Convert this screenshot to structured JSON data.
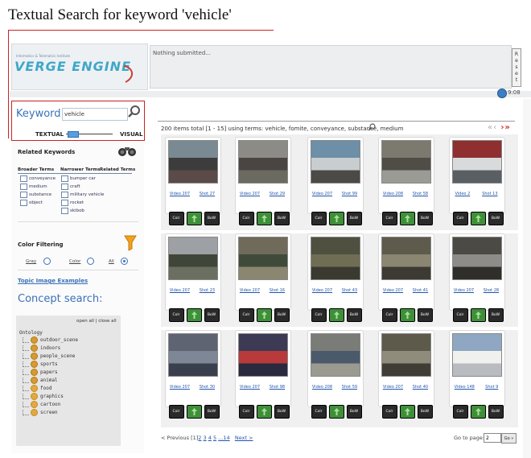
{
  "caption": "Textual Search for keyword 'vehicle'",
  "header": {
    "logo_small": "Informatics & Telematics Institute",
    "logo": "VERGE ENGINE",
    "status": "Nothing submitted...",
    "reset_label": [
      "R",
      "e",
      "s",
      "e",
      "t"
    ],
    "time": "9:08"
  },
  "search": {
    "label": "Keyword:",
    "value": "vehicle",
    "mode_left": "TEXTUAL",
    "mode_right": "VISUAL",
    "slider_level": 0.1
  },
  "related": {
    "title": "Related Keywords",
    "headers": [
      "Broader Terms",
      "Narrower Terms",
      "Related Terms"
    ],
    "broader": [
      "conveyance",
      "medium",
      "substance",
      "object"
    ],
    "narrower": [
      "bumper car",
      "craft",
      "military vehicle",
      "rocket",
      "skibob"
    ]
  },
  "color_filter": {
    "title": "Color Filtering",
    "options": [
      "Gray",
      "Color",
      "All"
    ],
    "selected": "All"
  },
  "topic_link": "Topic Image Examples",
  "concept": {
    "title": "Concept search:",
    "actions": "open all | close all",
    "root": "Ontology",
    "items": [
      "outdoor_scene",
      "indoors",
      "people_scene",
      "sports",
      "papers",
      "animal",
      "food",
      "graphics",
      "cartoon",
      "screen"
    ]
  },
  "results": {
    "info": "200 items total [1 - 15] using terms: vehicle, fomite, conveyance, substance, medium",
    "nav_prev": "«‹",
    "nav_next": "›»",
    "buttons": [
      "Colr",
      "",
      "BoW"
    ],
    "items": [
      {
        "video": "Video 207",
        "shot": "Shot 27"
      },
      {
        "video": "Video 207",
        "shot": "Shot 29"
      },
      {
        "video": "Video 207",
        "shot": "Shot 99"
      },
      {
        "video": "Video 208",
        "shot": "Shot 58"
      },
      {
        "video": "Video 2",
        "shot": "Shot 13"
      },
      {
        "video": "Video 207",
        "shot": "Shot 23"
      },
      {
        "video": "Video 207",
        "shot": "Shot 16"
      },
      {
        "video": "Video 207",
        "shot": "Shot 43"
      },
      {
        "video": "Video 207",
        "shot": "Shot 41"
      },
      {
        "video": "Video 207",
        "shot": "Shot 28"
      },
      {
        "video": "Video 207",
        "shot": "Shot 30"
      },
      {
        "video": "Video 207",
        "shot": "Shot 98"
      },
      {
        "video": "Video 208",
        "shot": "Shot 59"
      },
      {
        "video": "Video 207",
        "shot": "Shot 40"
      },
      {
        "video": "Video 148",
        "shot": "Shot 9"
      }
    ]
  },
  "pager": {
    "prev": "< Previous",
    "current": "[1]",
    "pages": [
      "2",
      "3",
      "4",
      "5",
      "...14"
    ],
    "next": "Next >",
    "goto_label": "Go to page:",
    "goto_value": "2",
    "goto_button": "Go »"
  },
  "colors": {
    "accent": "#3a72b8",
    "highlight": "#cc2222",
    "logo": "#3ea7c9"
  }
}
